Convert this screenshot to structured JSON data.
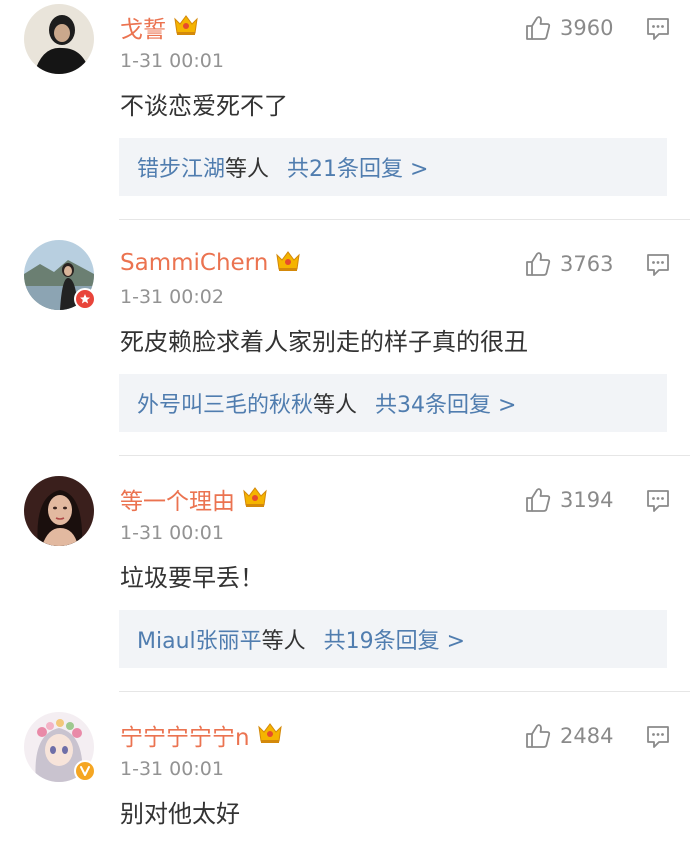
{
  "comments": [
    {
      "username": "戈誓",
      "time": "1-31 00:01",
      "text": "不谈恋爱死不了",
      "likes": "3960",
      "reply_users": "错步江湖",
      "reply_etc": "等人",
      "reply_count": "共21条回复 >",
      "badge": "none"
    },
    {
      "username": "SammiChern",
      "time": "1-31 00:02",
      "text": "死皮赖脸求着人家别走的样子真的很丑",
      "likes": "3763",
      "reply_users": "外号叫三毛的秋秋",
      "reply_etc": "等人",
      "reply_count": "共34条回复 >",
      "badge": "red-star-badge"
    },
    {
      "username": "等一个理由",
      "time": "1-31 00:01",
      "text": "垃圾要早丢！",
      "likes": "3194",
      "reply_users": "Miaul张丽平",
      "reply_etc": "等人",
      "reply_count": "共19条回复 >",
      "badge": "none"
    },
    {
      "username": "宁宁宁宁宁n",
      "time": "1-31 00:01",
      "text": "别对他太好",
      "likes": "2484",
      "badge": "yellow-verified-badge"
    }
  ],
  "colors": {
    "username": "#eb7350",
    "link": "#507daf",
    "muted": "#939393",
    "reply_bg": "#f2f4f7"
  }
}
